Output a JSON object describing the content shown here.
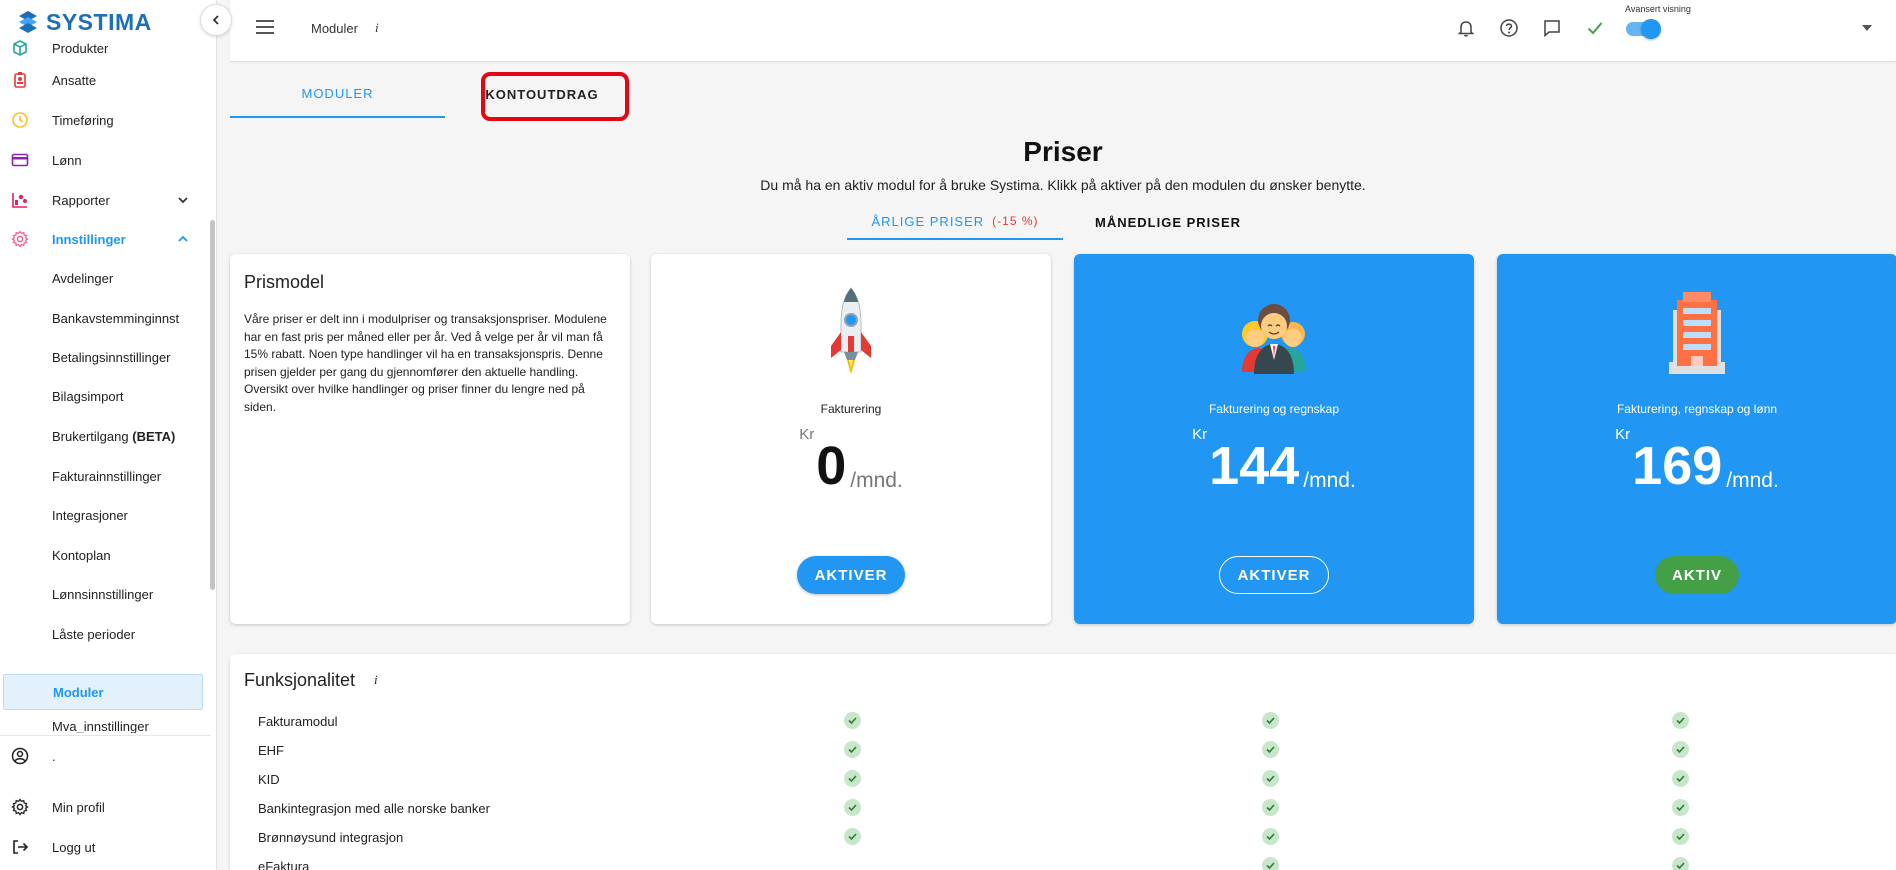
{
  "brand": {
    "name": "SYSTIMA",
    "color": "#1e6fb8"
  },
  "sidebar": {
    "items": [
      {
        "label": "Produkter",
        "icon": "box-icon",
        "color": "#26a69a"
      },
      {
        "label": "Ansatte",
        "icon": "badge-icon",
        "color": "#e53935"
      },
      {
        "label": "Timeføring",
        "icon": "clock-icon",
        "color": "#fbc02d"
      },
      {
        "label": "Lønn",
        "icon": "card-icon",
        "color": "#8e24aa"
      },
      {
        "label": "Rapporter",
        "icon": "chart-icon",
        "color": "#e91e63"
      },
      {
        "label": "Innstillinger",
        "icon": "gear-icon",
        "color": "#f06292"
      }
    ],
    "sub_items": [
      "Avdelinger",
      "Bankavstemminginnst",
      "Betalingsinnstillinger",
      "Bilagsimport",
      "Brukertilgang",
      "Fakturainnstillinger",
      "Integrasjoner",
      "Kontoplan",
      "Lønnsinnstillinger",
      "Låste perioder",
      "Moduler",
      "Mva_innstillinger"
    ],
    "beta_suffix": "(BETA)",
    "bottom": {
      "user_name": ".",
      "profile": "Min profil",
      "logout": "Logg ut"
    }
  },
  "topbar": {
    "title": "Moduler",
    "info": "i",
    "advanced_label": "Avansert visning",
    "advanced_on": true
  },
  "tabs": {
    "moduler": "MODULER",
    "kontoutdrag": "KONTOUTDRAG"
  },
  "priser": {
    "title": "Priser",
    "description": "Du må ha en aktiv modul for å bruke Systima. Klikk på aktiver på den modulen du ønsker benytte.",
    "tab_yearly": "ÅRLIGE PRISER",
    "tab_yearly_discount": "(-15 %)",
    "tab_monthly": "MÅNEDLIGE PRISER"
  },
  "prismodel": {
    "title": "Prismodel",
    "text": "Våre priser er delt inn i modulpriser og transaksjonspriser. Modulene har en fast pris per måned eller per år. Ved å velge per år vil man få 15% rabatt. Noen type handlinger vil ha en transaksjonspris. Denne prisen gjelder per gang du gjennomfører den aktuelle handling. Oversikt over hvilke handlinger og priser finner du lengre ned på siden."
  },
  "plans": [
    {
      "name": "Fakturering",
      "currency": "Kr",
      "price": "0",
      "period": "/mnd.",
      "button": "AKTIVER",
      "icon": "rocket-icon"
    },
    {
      "name": "Fakturering og regnskap",
      "currency": "Kr",
      "price": "144",
      "period": "/mnd.",
      "button": "AKTIVER",
      "icon": "people-icon"
    },
    {
      "name": "Fakturering, regnskap og lønn",
      "currency": "Kr",
      "price": "169",
      "period": "/mnd.",
      "button": "AKTIV",
      "icon": "building-icon"
    }
  ],
  "funksjonalitet": {
    "title": "Funksjonalitet",
    "info": "i",
    "features": [
      {
        "name": "Fakturamodul",
        "plans": [
          true,
          true,
          true
        ]
      },
      {
        "name": "EHF",
        "plans": [
          true,
          true,
          true
        ]
      },
      {
        "name": "KID",
        "plans": [
          true,
          true,
          true
        ]
      },
      {
        "name": "Bankintegrasjon med alle norske banker",
        "plans": [
          true,
          true,
          true
        ]
      },
      {
        "name": "Brønnøysund integrasjon",
        "plans": [
          true,
          true,
          true
        ]
      },
      {
        "name": "eFaktura",
        "plans": [
          false,
          true,
          true
        ]
      }
    ]
  }
}
